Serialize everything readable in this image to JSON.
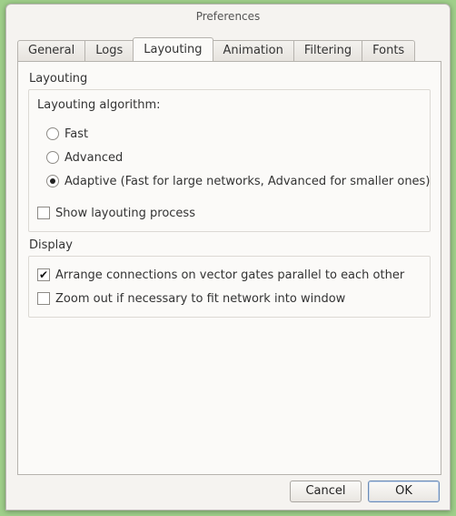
{
  "window": {
    "title": "Preferences"
  },
  "tabs": [
    {
      "label": "General",
      "active": false
    },
    {
      "label": "Logs",
      "active": false
    },
    {
      "label": "Layouting",
      "active": true
    },
    {
      "label": "Animation",
      "active": false
    },
    {
      "label": "Filtering",
      "active": false
    },
    {
      "label": "Fonts",
      "active": false
    }
  ],
  "layouting": {
    "section_label": "Layouting",
    "algorithm_label": "Layouting algorithm:",
    "options": [
      {
        "label": "Fast",
        "selected": false
      },
      {
        "label": "Advanced",
        "selected": false
      },
      {
        "label": "Adaptive (Fast for large networks, Advanced for smaller ones)",
        "selected": true
      }
    ],
    "show_process": {
      "label": "Show layouting process",
      "checked": false
    }
  },
  "display": {
    "section_label": "Display",
    "arrange_parallel": {
      "label": "Arrange connections on vector gates parallel to each other",
      "checked": true,
      "mark": "✔"
    },
    "zoom_out": {
      "label": "Zoom out if necessary to fit network into window",
      "checked": false
    }
  },
  "buttons": {
    "cancel_label": "Cancel",
    "ok_label": "OK"
  }
}
